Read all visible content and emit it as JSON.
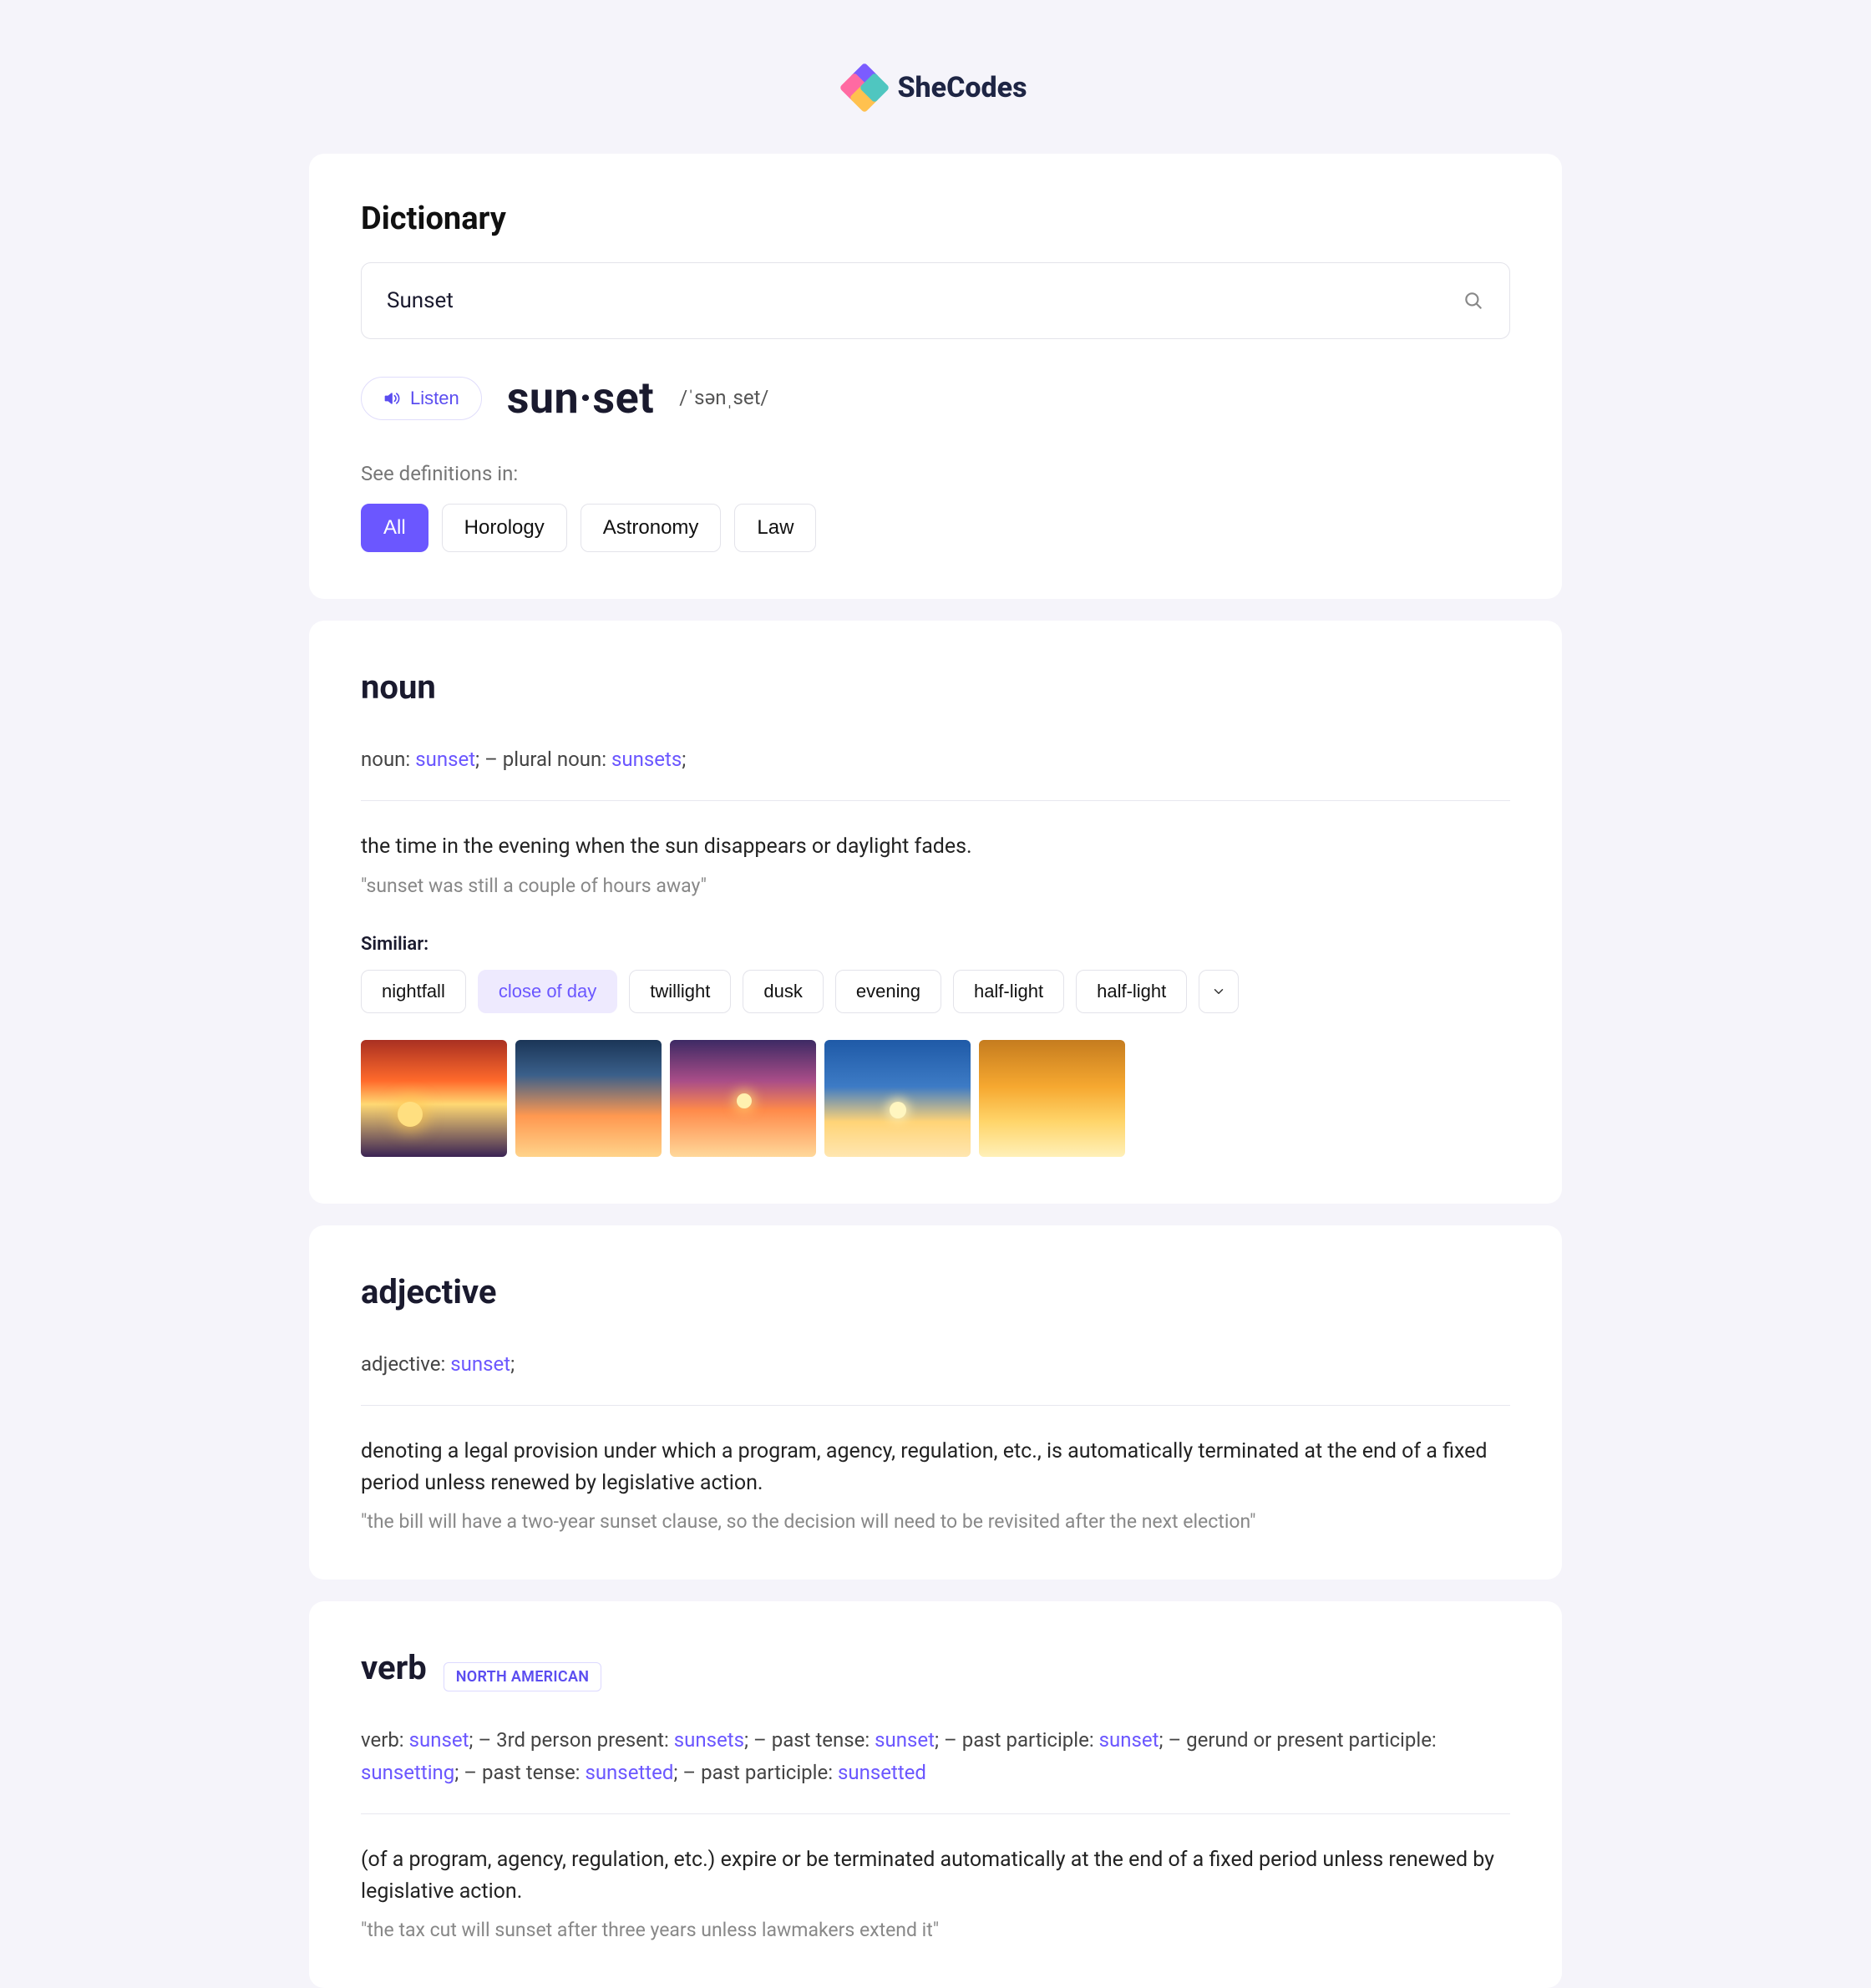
{
  "brand": {
    "name": "SheCodes"
  },
  "header": {
    "title": "Dictionary",
    "search_value": "Sunset"
  },
  "headline": {
    "listen_label": "Listen",
    "word": "sun·set",
    "phonetic": "/ˈsənˌset/"
  },
  "categories": {
    "label": "See definitions in:",
    "items": [
      "All",
      "Horology",
      "Astronomy",
      "Law"
    ],
    "active_index": 0
  },
  "entries": [
    {
      "pos": "noun",
      "forms_html": "noun: <b>sunset</b>;   –   plural noun: <b>sunsets</b>;",
      "definition": "the time in the evening when the sun disappears or daylight fades.",
      "example": "\"sunset was still a couple of hours away\"",
      "similar_label": "Similiar:",
      "similar": [
        {
          "text": "nightfall",
          "hl": false
        },
        {
          "text": "close of day",
          "hl": true
        },
        {
          "text": "twillight",
          "hl": false
        },
        {
          "text": "dusk",
          "hl": false
        },
        {
          "text": "evening",
          "hl": false
        },
        {
          "text": "half-light",
          "hl": false
        },
        {
          "text": "half-light",
          "hl": false
        }
      ],
      "has_images": true
    },
    {
      "pos": "adjective",
      "forms_html": "adjective: <b>sunset</b>;",
      "definition": "denoting a legal provision under which a program, agency, regulation, etc., is automatically terminated at the end of a fixed period unless renewed by legislative action.",
      "example": "\"the bill will have a two-year sunset clause, so the decision will need to be revisited after the next election\""
    },
    {
      "pos": "verb",
      "region": "NORTH AMERICAN",
      "forms_html": "verb: <b>sunset</b>;   –   3rd person present: <b>sunsets</b>;   –   past tense: <b>sunset</b>;   –   past participle: <b>sunset</b>;   –   gerund or present participle: <b>sunsetting</b>;   –   past tense: <b>sunsetted</b>;   –   past participle: <b>sunsetted</b>",
      "definition": "(of a program, agency, regulation, etc.) expire or be terminated automatically at the end of a fixed period unless renewed by legislative action.",
      "example": "\"the tax cut will sunset after three years unless lawmakers extend it\""
    }
  ]
}
